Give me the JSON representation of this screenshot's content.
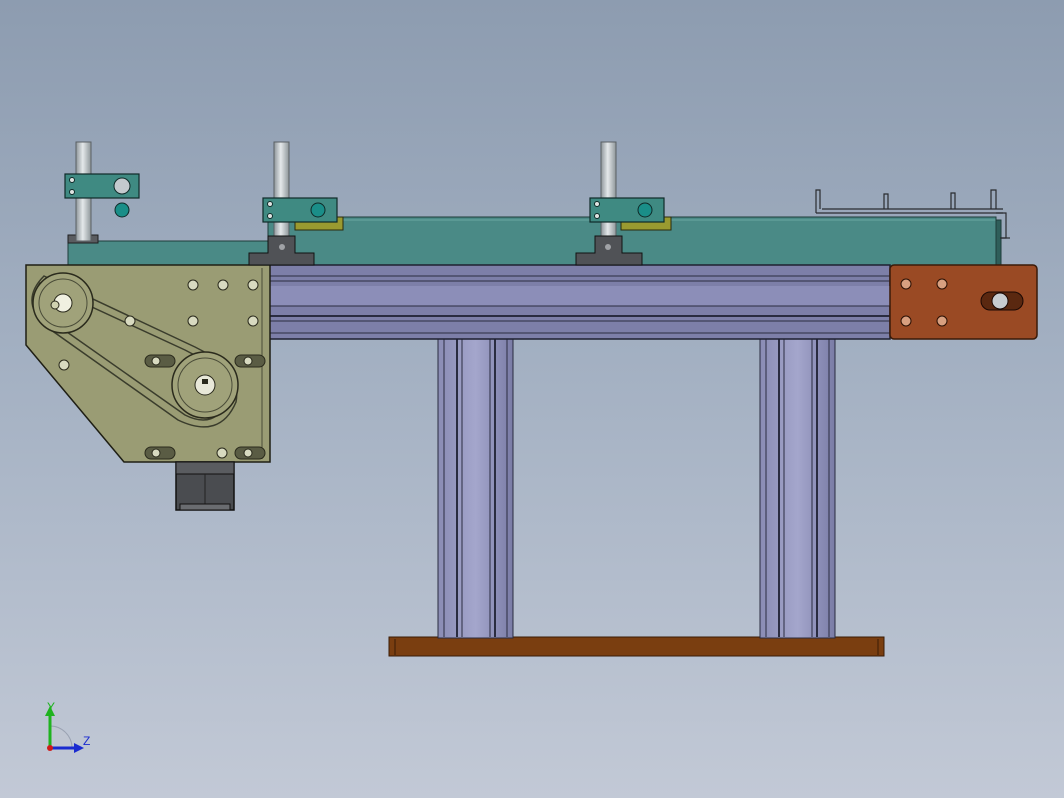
{
  "viewport": {
    "background_top": "#8d9cb0",
    "background_bottom": "#c2c9d6"
  },
  "model": {
    "frame_color": "#7d7fa8",
    "conveyor_color": "#4a8a86",
    "drive_plate_color": "#9a9c74",
    "end_plate_color": "#9a4a24",
    "base_plate_color": "#7a3e10",
    "clamp_color": "#3f8a82",
    "guide_rod_color": "#c4cace",
    "motor_color": "#4a4c50"
  },
  "triad": {
    "y_label": "Y",
    "z_label": "Z",
    "y_color": "#1fb31f",
    "z_color": "#1a2bd0",
    "x_color": "#d01a1a"
  }
}
